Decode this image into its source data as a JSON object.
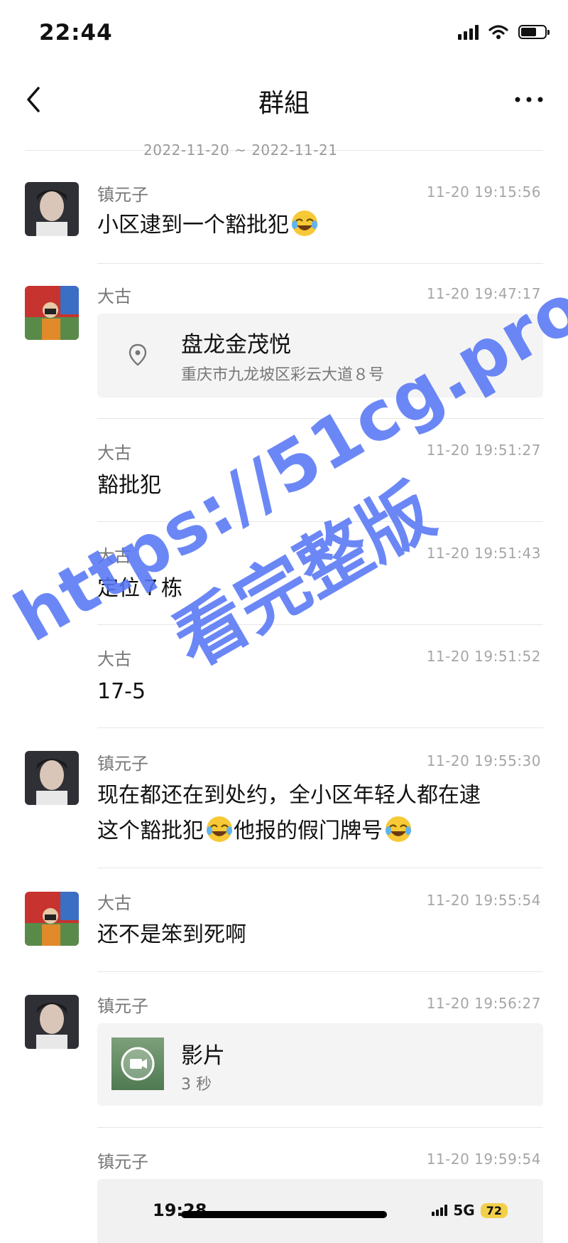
{
  "status_bar": {
    "time": "22:44",
    "signal_icon": "signal-bars-icon",
    "wifi_icon": "wifi-icon",
    "battery_level": 0.65
  },
  "nav": {
    "title": "群組",
    "back_icon": "chevron-left-icon",
    "more_icon": "more-horizontal-icon"
  },
  "date_range": "2022-11-20 ~ 2022-11-21",
  "messages": [
    {
      "sender": "镇元子",
      "time": "11-20 19:15:56",
      "text": "小区逮到一个豁批犯",
      "emoji": "joy-emoji"
    },
    {
      "sender": "大古",
      "time": "11-20 19:47:17",
      "location": {
        "title": "盘龙金茂悦",
        "address": "重庆市九龙坡区彩云大道８号",
        "icon": "location-pin-icon"
      }
    },
    {
      "sender": "大古",
      "time": "11-20 19:51:27",
      "text": "豁批犯"
    },
    {
      "sender": "大古",
      "time": "11-20 19:51:43",
      "text": "定位７栋"
    },
    {
      "sender": "大古",
      "time": "11-20 19:51:52",
      "text": "17-5"
    },
    {
      "sender": "镇元子",
      "time": "11-20 19:55:30",
      "text_line1": "现在都还在到处约，全小区年轻人都在逮",
      "text_line2a": "这个豁批犯",
      "text_line2b": "他报的假门牌号"
    },
    {
      "sender": "大古",
      "time": "11-20 19:55:54",
      "text": "还不是笨到死啊"
    },
    {
      "sender": "镇元子",
      "time": "11-20 19:56:27",
      "video": {
        "title": "影片",
        "duration": "3 秒",
        "icon": "video-camera-icon"
      }
    },
    {
      "sender": "镇元子",
      "time": "11-20 19:59:54",
      "screenshot": {
        "time": "19:28",
        "network": "5G",
        "battery": "72"
      }
    }
  ],
  "watermark": {
    "line1": "https://51cg.pro/",
    "line2": "看完整版"
  }
}
